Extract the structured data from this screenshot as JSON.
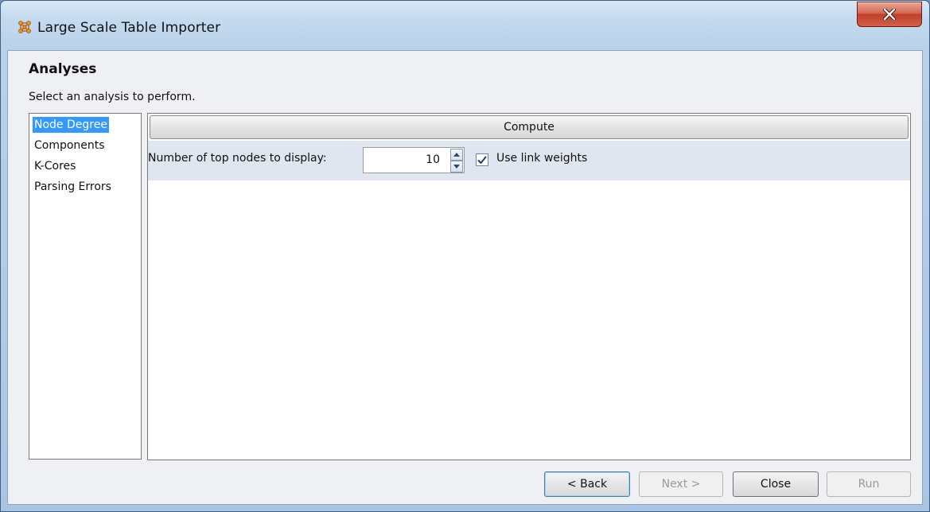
{
  "window": {
    "title": "Large Scale Table Importer",
    "close_symbol": "X"
  },
  "page": {
    "heading": "Analyses",
    "subheading": "Select an analysis to perform."
  },
  "analyses": {
    "items": [
      {
        "label": "Node Degree",
        "selected": true
      },
      {
        "label": "Components",
        "selected": false
      },
      {
        "label": "K-Cores",
        "selected": false
      },
      {
        "label": "Parsing Errors",
        "selected": false
      }
    ]
  },
  "panel": {
    "compute_label": "Compute",
    "top_nodes_label": "Number of top nodes to display:",
    "top_nodes_value": "10",
    "use_link_weights_label": "Use link weights",
    "use_link_weights_checked": true
  },
  "footer": {
    "back_label": "< Back",
    "next_label": "Next >",
    "close_label": "Close",
    "run_label": "Run"
  },
  "colors": {
    "selection": "#3399ff",
    "close_button": "#c2402a",
    "options_row": "#e0e6ef"
  }
}
